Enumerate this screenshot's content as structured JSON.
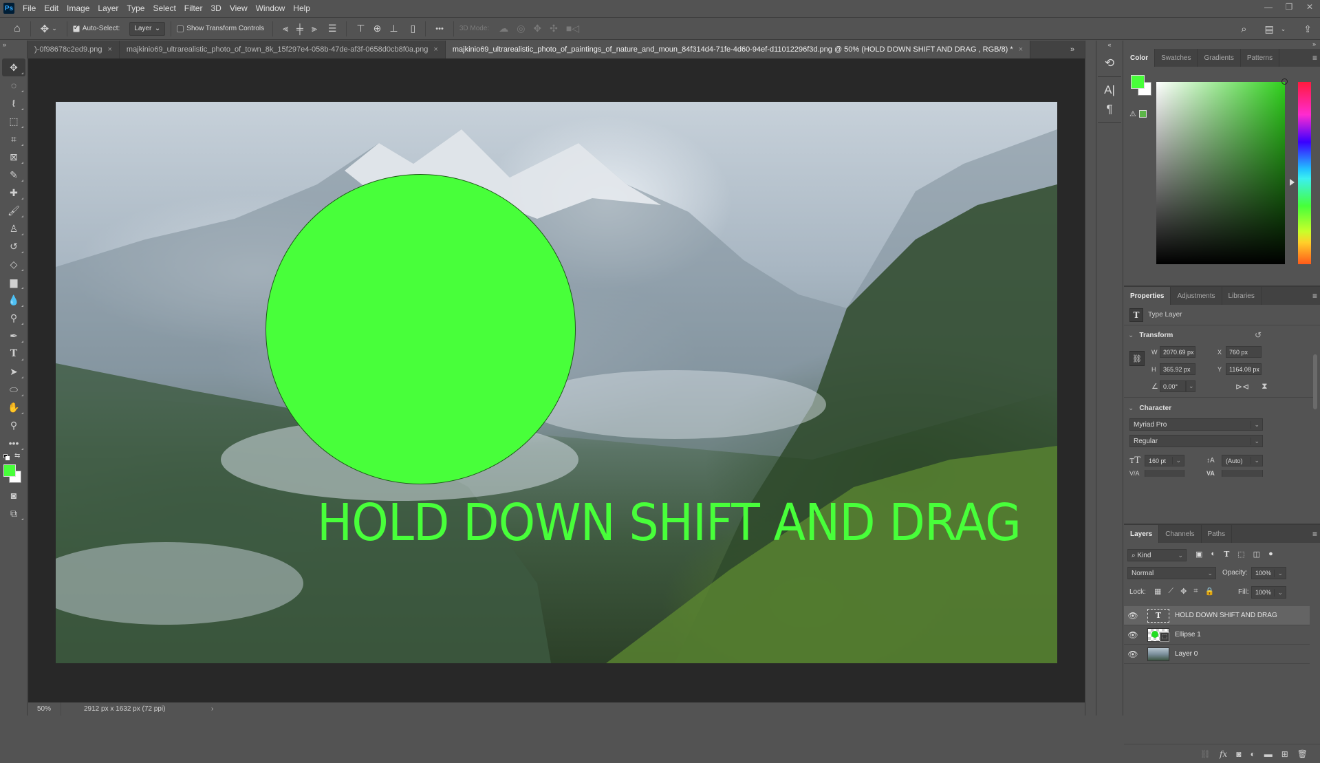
{
  "app": {
    "logo": "Ps",
    "menu": [
      "File",
      "Edit",
      "Image",
      "Layer",
      "Type",
      "Select",
      "Filter",
      "3D",
      "View",
      "Window",
      "Help"
    ],
    "window_controls": {
      "minimize": "—",
      "restore": "❐",
      "close": "✕"
    }
  },
  "options_bar": {
    "auto_select_label": "Auto-Select:",
    "auto_select_checked": true,
    "auto_select_target": "Layer",
    "show_transform_label": "Show Transform Controls",
    "show_transform_checked": false,
    "more_label": "•••",
    "mode_3d_label": "3D Mode:"
  },
  "tabs": [
    {
      "label": ")-0f98678c2ed9.png",
      "active": false
    },
    {
      "label": "majkinio69_ultrarealistic_photo_of_town_8k_15f297e4-058b-47de-af3f-0658d0cb8f0a.png",
      "active": false
    },
    {
      "label": "majkinio69_ultrarealistic_photo_of_paintings_of_nature_and_moun_84f314d4-71fe-4d60-94ef-d11012296f3d.png @ 50% (HOLD DOWN SHIFT AND DRAG , RGB/8) *",
      "active": true
    }
  ],
  "tab_close_glyph": "×",
  "tab_overflow_glyph": "»",
  "canvas": {
    "text_layer_content": "HOLD DOWN SHIFT AND DRAG",
    "text_color": "#48ff3a",
    "ellipse_color": "#48ff3a"
  },
  "status_bar": {
    "zoom": "50%",
    "doc_info": "2912 px x 1632 px (72 ppi)",
    "arrow": "›"
  },
  "color_panel": {
    "tabs": [
      "Color",
      "Swatches",
      "Gradients",
      "Patterns"
    ],
    "active_tab": "Color",
    "foreground": "#48ff3a",
    "background": "#ffffff"
  },
  "properties_panel": {
    "tabs": [
      "Properties",
      "Adjustments",
      "Libraries"
    ],
    "active_tab": "Properties",
    "layer_type_label": "Type Layer",
    "transform": {
      "heading": "Transform",
      "w_label": "W",
      "w_value": "2070.69 px",
      "h_label": "H",
      "h_value": "365.92 px",
      "x_label": "X",
      "x_value": "760 px",
      "y_label": "Y",
      "y_value": "1164.08 px",
      "angle_value": "0.00°"
    },
    "character": {
      "heading": "Character",
      "font_family": "Myriad Pro",
      "font_style": "Regular",
      "font_size": "160 pt",
      "leading": "(Auto)",
      "kerning_label": "V/A",
      "tracking_label": "VA"
    }
  },
  "layers_panel": {
    "tabs": [
      "Layers",
      "Channels",
      "Paths"
    ],
    "active_tab": "Layers",
    "filter_kind": "Kind",
    "blend_mode": "Normal",
    "opacity_label": "Opacity:",
    "opacity_value": "100%",
    "lock_label": "Lock:",
    "fill_label": "Fill:",
    "fill_value": "100%",
    "layers": [
      {
        "name": "HOLD DOWN SHIFT AND DRAG",
        "type": "text",
        "visible": true,
        "selected": true
      },
      {
        "name": "Ellipse 1",
        "type": "shape",
        "visible": true,
        "selected": false
      },
      {
        "name": "Layer 0",
        "type": "image",
        "visible": true,
        "selected": false
      }
    ]
  }
}
